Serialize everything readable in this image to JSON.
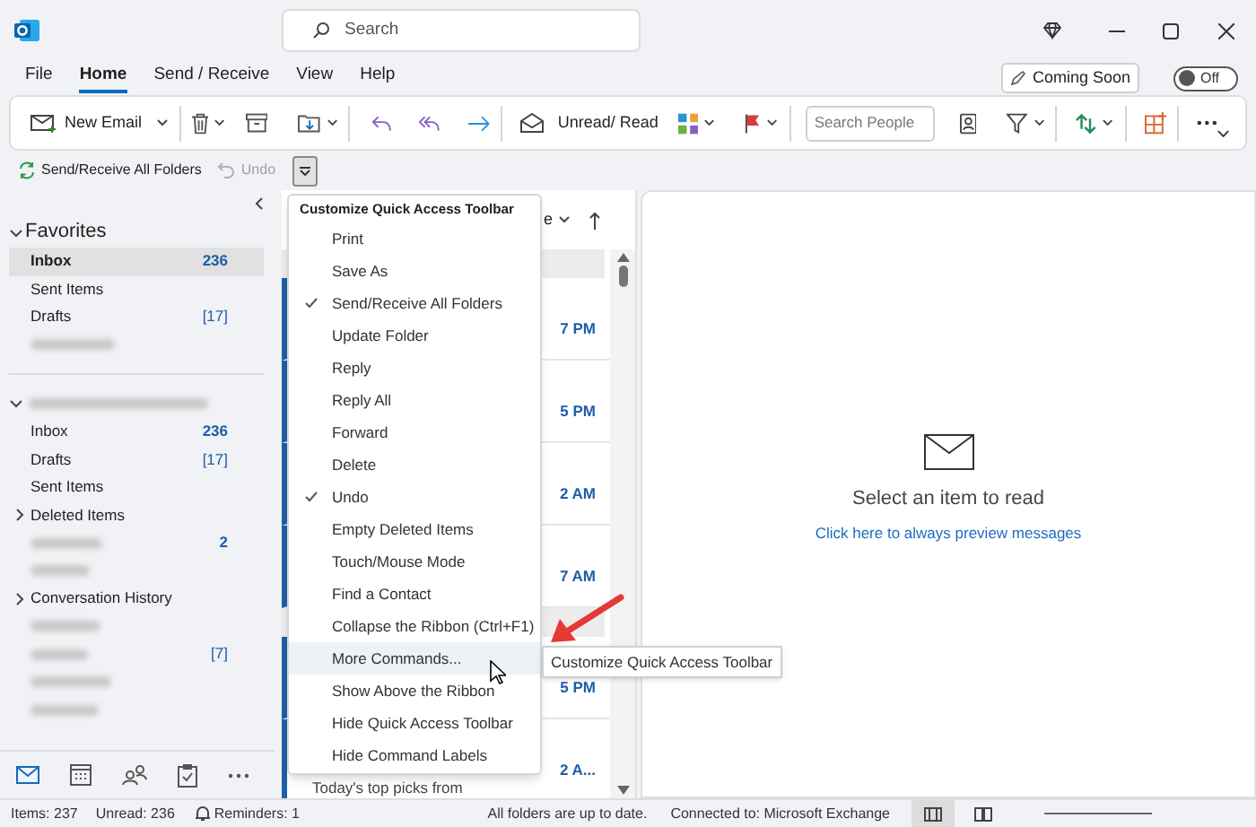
{
  "window": {
    "search_placeholder": "Search"
  },
  "menu_bar": [
    {
      "label": "File",
      "selected": false
    },
    {
      "label": "Home",
      "selected": true
    },
    {
      "label": "Send / Receive",
      "selected": false
    },
    {
      "label": "View",
      "selected": false
    },
    {
      "label": "Help",
      "selected": false
    }
  ],
  "coming_soon": {
    "label": "Coming Soon"
  },
  "toggle": {
    "label": "Off",
    "on": false
  },
  "ribbon": {
    "new_email": "New Email",
    "unread_read": "Unread/ Read",
    "search_people": {
      "placeholder": "Search People"
    }
  },
  "quick_access": [
    {
      "label": "Send/Receive All Folders",
      "disabled": false
    },
    {
      "label": "Undo",
      "disabled": true
    }
  ],
  "customize_button": {
    "pressed": true
  },
  "folders": {
    "favorites": {
      "label": "Favorites",
      "expanded": true,
      "items": [
        {
          "kind": "folder",
          "label": "Inbox",
          "count": "236",
          "count_bold": true,
          "selected": true
        },
        {
          "kind": "folder",
          "label": "Sent Items",
          "selected": false
        },
        {
          "kind": "folder",
          "label": "Drafts",
          "count": "[17]",
          "count_bold": false,
          "selected": false
        },
        {
          "kind": "blurred",
          "selected": false
        }
      ]
    },
    "account": {
      "expanded": true,
      "items": [
        {
          "kind": "folder",
          "label": "Inbox",
          "count": "236",
          "count_bold": true,
          "selected": false
        },
        {
          "kind": "folder",
          "label": "Drafts",
          "count": "[17]",
          "count_bold": false,
          "selected": false
        },
        {
          "kind": "folder",
          "label": "Sent Items",
          "selected": false
        },
        {
          "kind": "folder",
          "label": "Deleted Items",
          "expanded": false,
          "selected": false
        },
        {
          "kind": "blurred",
          "count": "2",
          "count_bold": true,
          "selected": false
        },
        {
          "kind": "blurred",
          "selected": false
        },
        {
          "kind": "folder",
          "label": "Conversation History",
          "expanded": false,
          "selected": false
        },
        {
          "kind": "blurred",
          "selected": false
        },
        {
          "kind": "blurred",
          "count": "[7]",
          "count_bold": false,
          "selected": false
        },
        {
          "kind": "blurred",
          "selected": false
        },
        {
          "kind": "blurred",
          "selected": false
        }
      ]
    }
  },
  "nav": [
    {
      "kind": "mail",
      "selected": true
    },
    {
      "kind": "calendar",
      "selected": false
    },
    {
      "kind": "people",
      "selected": false
    },
    {
      "kind": "tasks",
      "selected": false
    },
    {
      "kind": "more",
      "selected": false
    }
  ],
  "message_list": {
    "sort_label": "e",
    "rows": [
      {
        "kind": "group"
      },
      {
        "kind": "message",
        "time": "7 PM",
        "unread": true
      },
      {
        "kind": "message",
        "time": "5 PM",
        "unread": true
      },
      {
        "kind": "message",
        "time": "2 AM",
        "unread": true
      },
      {
        "kind": "message",
        "time": "7 AM",
        "unread": true
      },
      {
        "kind": "group"
      },
      {
        "kind": "message",
        "time": "5 PM",
        "unread": true
      },
      {
        "kind": "message",
        "time": "2 A...",
        "preview": "Today's top picks from",
        "unread": true
      }
    ]
  },
  "context_menu": {
    "title": "Customize Quick Access Toolbar",
    "items": [
      {
        "label": "Print",
        "checked": false,
        "highlighted": false
      },
      {
        "label": "Save As",
        "checked": false,
        "highlighted": false
      },
      {
        "label": "Send/Receive All Folders",
        "checked": true,
        "highlighted": false
      },
      {
        "label": "Update Folder",
        "checked": false,
        "highlighted": false
      },
      {
        "label": "Reply",
        "checked": false,
        "highlighted": false
      },
      {
        "label": "Reply All",
        "checked": false,
        "highlighted": false
      },
      {
        "label": "Forward",
        "checked": false,
        "highlighted": false
      },
      {
        "label": "Delete",
        "checked": false,
        "highlighted": false
      },
      {
        "label": "Undo",
        "checked": true,
        "highlighted": false
      },
      {
        "label": "Empty Deleted Items",
        "checked": false,
        "highlighted": false
      },
      {
        "label": "Touch/Mouse Mode",
        "checked": false,
        "highlighted": false
      },
      {
        "label": "Find a Contact",
        "checked": false,
        "highlighted": false
      },
      {
        "label": "Collapse the Ribbon (Ctrl+F1)",
        "checked": false,
        "highlighted": false
      },
      {
        "label": "More Commands...",
        "checked": false,
        "highlighted": true
      },
      {
        "label": "Show Above the Ribbon",
        "checked": false,
        "highlighted": false
      },
      {
        "label": "Hide Quick Access Toolbar",
        "checked": false,
        "highlighted": false
      },
      {
        "label": "Hide Command Labels",
        "checked": false,
        "highlighted": false
      }
    ]
  },
  "tooltip": "Customize Quick Access Toolbar",
  "reading_pane": {
    "message": "Select an item to read",
    "link": "Click here to always preview messages"
  },
  "status_bar": {
    "items": "Items: 237",
    "unread": "Unread: 236",
    "reminders": "Reminders: 1",
    "sync": "All folders are up to date.",
    "connection": "Connected to: Microsoft Exchange",
    "views": [
      {
        "kind": "normal",
        "selected": true
      },
      {
        "kind": "reading",
        "selected": false
      }
    ]
  }
}
